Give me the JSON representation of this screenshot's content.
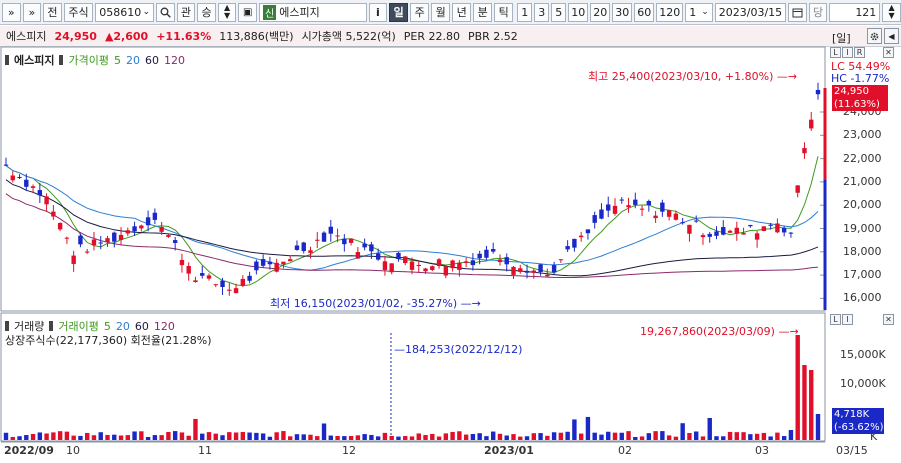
{
  "toolbar": {
    "nav_prev": "»",
    "nav_next": "»",
    "jeon": "전",
    "market_type": "주식",
    "code": "058610",
    "gwan": "관",
    "sang": "승",
    "shin_badge": "신",
    "stock_name": "에스피지",
    "info": "i",
    "periods": [
      "일",
      "주",
      "월",
      "년",
      "분",
      "틱"
    ],
    "active_period": "일",
    "intervals": [
      "1",
      "3",
      "5",
      "10",
      "20",
      "30",
      "60",
      "120"
    ],
    "count_value": "1",
    "date": "2023/03/15",
    "dang": "당",
    "bars": "121"
  },
  "infobar": {
    "name": "에스피지",
    "price": "24,950",
    "change": "▲2,600",
    "change_pct": "+11.63%",
    "volume_amount": "113,886(백만)",
    "mcap": "시가총액 5,522(억)",
    "per": "PER 22.80",
    "pbr": "PBR 2.52",
    "period_tag": "[일]"
  },
  "price_panel": {
    "legend_name": "에스피지",
    "legend_ma_title": "가격이평",
    "ma_labels": [
      "5",
      "20",
      "60",
      "120"
    ],
    "high_annot": "최고 25,400(2023/03/10, +1.80%)",
    "low_annot": "최저 16,150(2023/01/02, -35.27%)",
    "lc": "LC  54.49%",
    "hc": "HC  -1.77%",
    "current_price": "24,950",
    "current_pct": "(11.63%)",
    "axis_ticks": [
      "24,000",
      "23,000",
      "22,000",
      "21,000",
      "20,000",
      "19,000",
      "18,000",
      "17,000",
      "16,000"
    ]
  },
  "volume_panel": {
    "legend_title": "거래량",
    "legend_ma_title": "거래이평",
    "ma_labels": [
      "5",
      "20",
      "60",
      "120"
    ],
    "shares_info": "상장주식수(22,177,360) 회전율(21.28%)",
    "high_annot": "19,267,860(2023/03/09)",
    "low_annot": "184,253(2022/12/12)",
    "axis_ticks": [
      "15,000K",
      "10,000K",
      "K"
    ],
    "current_vol": "4,718K",
    "current_pct": "(-63.62%)"
  },
  "x_axis": {
    "labels": [
      "2022/09",
      "10",
      "11",
      "12",
      "2023/01",
      "02",
      "03",
      "03/15"
    ]
  },
  "colors": {
    "up": "#e0102a",
    "down": "#1a28c8",
    "ma5": "#3d9a1e",
    "ma20": "#2b7fd4",
    "ma60": "#1a1a40",
    "ma120": "#8a2a6a"
  }
}
